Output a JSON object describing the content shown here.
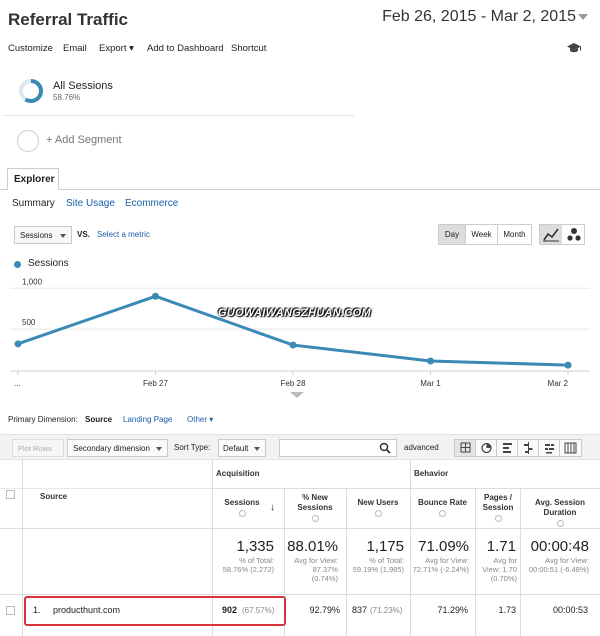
{
  "header": {
    "title": "Referral Traffic",
    "date_range": "Feb 26, 2015 - Mar 2, 2015"
  },
  "toolbar": {
    "items": [
      "Customize",
      "Email",
      "Export ▾",
      "Add to Dashboard",
      "Shortcut"
    ]
  },
  "segments": {
    "all_sessions": "All Sessions",
    "all_sessions_pct": "58.76%",
    "all_sessions_fraction": 0.5876,
    "add_segment": "+ Add Segment"
  },
  "explorer": {
    "tab_label": "Explorer",
    "subtabs": [
      "Summary",
      "Site Usage",
      "Ecommerce"
    ]
  },
  "chart_controls": {
    "metric": "Sessions",
    "vs": "VS.",
    "select_metric": "Select a metric",
    "periods": [
      "Day",
      "Week",
      "Month"
    ],
    "active_period": "Day"
  },
  "chart_data": {
    "type": "line",
    "series": [
      {
        "name": "Sessions",
        "values": [
          320,
          902,
          305,
          110,
          60
        ]
      }
    ],
    "x": [
      "...",
      "Feb 27",
      "Feb 28",
      "Mar 1",
      "Mar 2"
    ],
    "y_ticks": [
      "1,000",
      "500"
    ],
    "ylim": [
      0,
      1150
    ],
    "color": "#3b8ab5",
    "grid": true,
    "legend": "top-left"
  },
  "watermark": "GUOWAIWANGZHUAN.COM",
  "dimension": {
    "label": "Primary Dimension:",
    "active": "Source",
    "options": [
      "Landing Page",
      "Other ▾"
    ]
  },
  "table_tools": {
    "plot_rows": "Plot Rows",
    "secondary_dimension": "Secondary dimension",
    "sort_type_label": "Sort Type:",
    "sort_type_value": "Default",
    "advanced": "advanced"
  },
  "table": {
    "source_header": "Source",
    "group_acquisition": "Acquisition",
    "group_behavior": "Behavior",
    "columns": [
      "Sessions",
      "% New Sessions",
      "New Users",
      "Bounce Rate",
      "Pages / Session",
      "Avg. Session Duration"
    ],
    "totals": [
      {
        "value": "1,335",
        "sub": "% of Total: 58.76% (2,272)"
      },
      {
        "value": "88.01%",
        "sub": "Avg for View: 87.37% (0.74%)"
      },
      {
        "value": "1,175",
        "sub": "% of Total: 59.19% (1,985)"
      },
      {
        "value": "71.09%",
        "sub": "Avg for View: 72.71% (-2.24%)"
      },
      {
        "value": "1.71",
        "sub": "Avg for View: 1.70 (0.70%)"
      },
      {
        "value": "00:00:48",
        "sub": "Avg for View: 00:00:51 (-6.48%)"
      }
    ],
    "row1": {
      "index": "1.",
      "source": "producthunt.com",
      "sessions": "902",
      "sessions_pct": "(67.57%)",
      "pct_new": "92.79%",
      "new_users": "837",
      "new_users_pct": "(71.23%)",
      "bounce": "71.29%",
      "pages": "1.73",
      "duration": "00:00:53"
    }
  },
  "colors": {
    "accent": "#3b8ab5",
    "highlight": "#d9343a",
    "link": "#1a5fa8"
  }
}
